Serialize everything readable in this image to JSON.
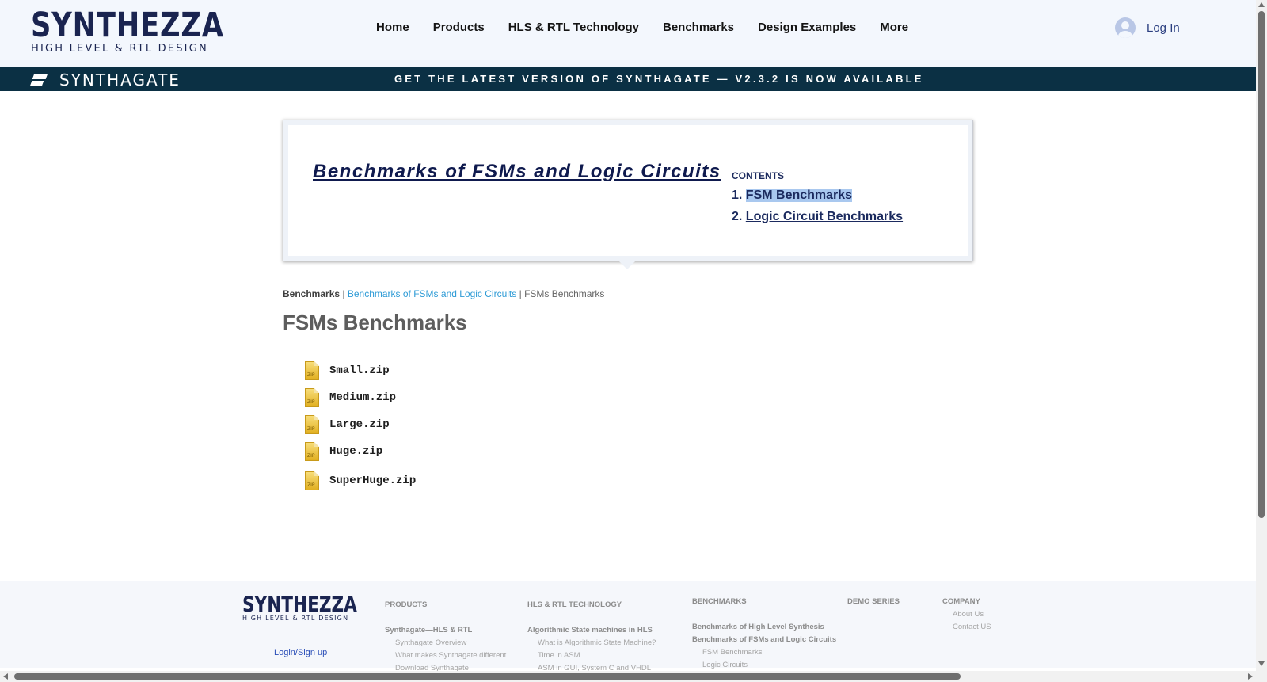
{
  "header": {
    "logo_main": "SYNTHEZZA",
    "logo_sub": "HIGH LEVEL & RTL DESIGN",
    "nav": [
      "Home",
      "Products",
      "HLS & RTL Technology",
      "Benchmarks",
      "Design Examples",
      "More"
    ],
    "login_label": "Log In"
  },
  "banner": {
    "logo_text": "SYNTHAGATE",
    "message": "GET THE LATEST VERSION OF SYNTHAGATE — V2.3.2 IS NOW AVAILABLE",
    "background": "#0b3044"
  },
  "card": {
    "title": "Benchmarks of FSMs and Logic Circuits",
    "contents_label": "CONTENTS",
    "contents_items": [
      {
        "num": "1.",
        "label": "FSM Benchmarks",
        "selected": true
      },
      {
        "num": "2.",
        "label": "Logic Circuit Benchmarks",
        "selected": false
      }
    ]
  },
  "breadcrumb": {
    "root": "Benchmarks",
    "sep1": " | ",
    "parent": "Benchmarks of FSMs and Logic Circuits",
    "sep2": " | ",
    "current": "FSMs Benchmarks"
  },
  "main": {
    "title": "FSMs Benchmarks",
    "files": [
      "Small.zip",
      "Medium.zip",
      "Large.zip",
      "Huge.zip",
      "SuperHuge.zip"
    ]
  },
  "footer": {
    "logo_main": "SYNTHEZZA",
    "logo_sub": "HIGH LEVEL & RTL DESIGN",
    "login": "Login/Sign up",
    "products": {
      "head": "PRODUCTS",
      "group": "Synthagate—HLS & RTL",
      "items": [
        "Synthagate Overview",
        "What makes Synthagate different",
        "Download Synthagate"
      ]
    },
    "hls": {
      "head": "HLS & RTL TECHNOLOGY",
      "group": "Algorithmic State machines in HLS",
      "items": [
        "What is Algorithmic State Machine?",
        "Time in ASM",
        "ASM in GUI, System C and VHDL"
      ]
    },
    "benchmarks": {
      "head": "BENCHMARKS",
      "groups": [
        "Benchmarks of High Level Synthesis",
        "Benchmarks of FSMs and Logic Circuits"
      ],
      "items": [
        "FSM Benchmarks",
        "Logic Circuits"
      ]
    },
    "demo": {
      "head": "DEMO SERIES"
    },
    "company": {
      "head": "COMPANY",
      "items": [
        "About Us",
        "Contact US"
      ]
    }
  }
}
